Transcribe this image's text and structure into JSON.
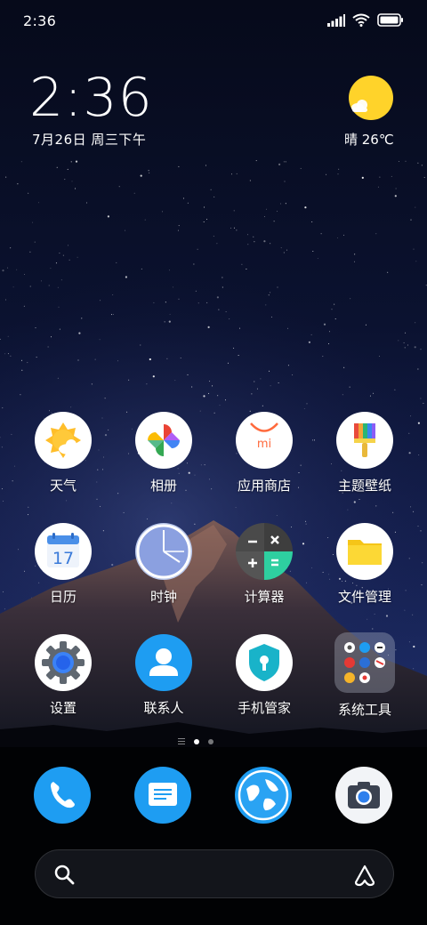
{
  "status_bar": {
    "time": "2:36",
    "icons": [
      "signal-icon",
      "wifi-icon",
      "battery-icon"
    ]
  },
  "clock_widget": {
    "time": "2:36",
    "date": "7月26日 周三下午"
  },
  "weather_widget": {
    "text": "晴 26℃",
    "icon": "sun-icon",
    "sun_color": "#ffd32a"
  },
  "apps": [
    {
      "label": "天气",
      "icon": "weather-icon"
    },
    {
      "label": "相册",
      "icon": "gallery-icon"
    },
    {
      "label": "应用商店",
      "icon": "app-store-icon"
    },
    {
      "label": "主题壁纸",
      "icon": "themes-icon"
    },
    {
      "label": "日历",
      "icon": "calendar-icon",
      "badge": "17"
    },
    {
      "label": "时钟",
      "icon": "clock-icon"
    },
    {
      "label": "计算器",
      "icon": "calculator-icon"
    },
    {
      "label": "文件管理",
      "icon": "file-manager-icon"
    },
    {
      "label": "设置",
      "icon": "settings-icon"
    },
    {
      "label": "联系人",
      "icon": "contacts-icon"
    },
    {
      "label": "手机管家",
      "icon": "security-icon"
    },
    {
      "label": "系统工具",
      "icon": "tools-folder-icon"
    }
  ],
  "page_indicator": {
    "pages": 2,
    "current": 1
  },
  "dock": [
    {
      "icon": "phone-icon"
    },
    {
      "icon": "messages-icon"
    },
    {
      "icon": "browser-icon"
    },
    {
      "icon": "camera-icon"
    }
  ],
  "search_bar": {
    "left_icon": "search-icon",
    "right_icon": "assistant-icon"
  },
  "colors": {
    "accent_blue": "#1e9df2",
    "wallpaper_sky": "#070d2a"
  }
}
